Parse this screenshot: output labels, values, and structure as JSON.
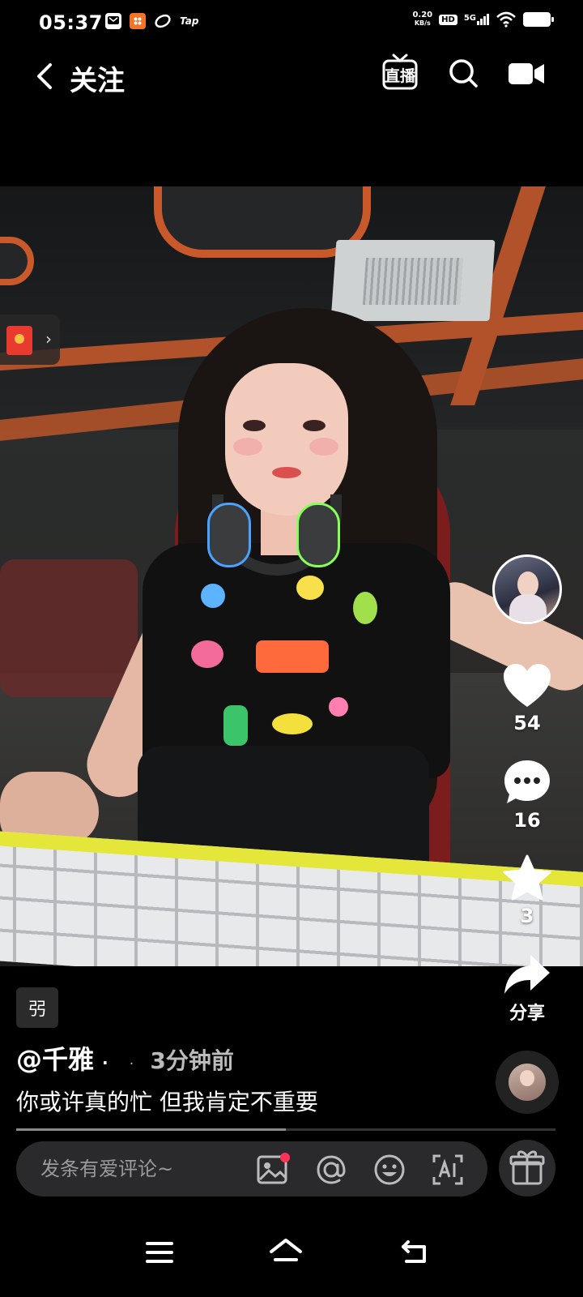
{
  "status_bar": {
    "time": "05:37",
    "net_speed_value": "0.20",
    "net_speed_unit": "KB/s",
    "hd": "HD",
    "network": "5G",
    "tap_label": "Tap"
  },
  "header": {
    "title": "关注",
    "live_label": "直播"
  },
  "video": {
    "likes": "54",
    "comments": "16",
    "favorites": "3",
    "share_label": "分享",
    "tag": "弜",
    "author": "@千雅",
    "author_dot": "·",
    "time_dot": "·",
    "time_ago": "3分钟前",
    "caption": "你或许真的忙 但我肯定不重要",
    "progress": 0.5
  },
  "comment_bar": {
    "placeholder": "发条有爱评论~"
  },
  "icons": [
    "back-arrow-icon",
    "live-icon",
    "search-icon",
    "camera-icon",
    "red-envelope-icon",
    "heart-icon",
    "comment-icon",
    "star-icon",
    "share-icon",
    "image-icon",
    "mention-icon",
    "emoji-icon",
    "ai-icon",
    "gift-icon",
    "menu-icon",
    "home-icon",
    "back-icon"
  ],
  "colors": {
    "accent_red": "#ff3355",
    "background": "#000000",
    "envelope_red": "#e83a2f"
  }
}
